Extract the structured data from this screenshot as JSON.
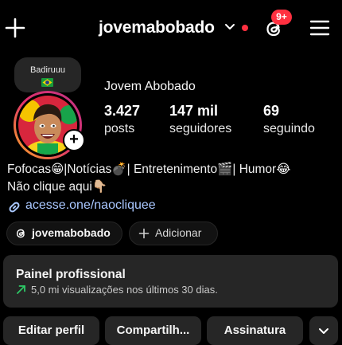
{
  "header": {
    "username": "jovemabobado",
    "notification_badge": "9+",
    "icons": [
      "plus-icon",
      "chevron-down-icon",
      "threads-icon",
      "menu-icon"
    ]
  },
  "note": {
    "text": "Badiruuu",
    "flag": "brazil-flag-emoji"
  },
  "profile": {
    "display_name": "Jovem Abobado",
    "stats": [
      {
        "value": "3.427",
        "label": "posts"
      },
      {
        "value": "147 mil",
        "label": "seguidores"
      },
      {
        "value": "69",
        "label": "seguindo"
      }
    ],
    "bio_line1": "Fofocas😁|Notícias💣| Entretenimento🎬| Humor😂",
    "bio_line2": "Não clique aqui👇🏼",
    "link": "acesse.one/naocliquee"
  },
  "chips": {
    "threads_label": "jovemabobado",
    "add_label": "Adicionar"
  },
  "panel": {
    "title": "Painel profissional",
    "subtitle": "5,0 mi visualizações nos últimos 30 dias."
  },
  "buttons": {
    "edit": "Editar perfil",
    "share": "Compartilh...",
    "subscription": "Assinatura"
  },
  "colors": {
    "background": "#000000",
    "surface": "#262626",
    "badge_red": "#ff3040",
    "link_blue": "#a9c7ff",
    "trend_green": "#2ec866"
  }
}
